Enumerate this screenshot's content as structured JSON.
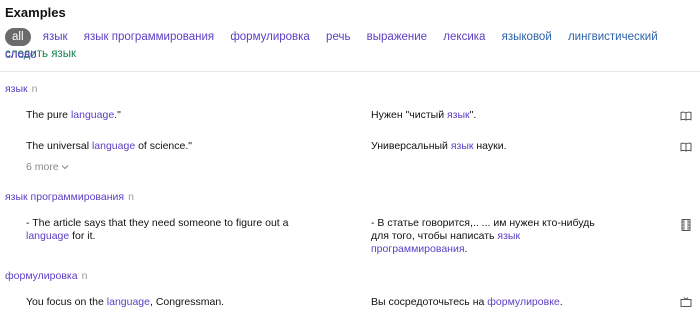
{
  "page": {
    "title": "Examples"
  },
  "filters": {
    "all": "all",
    "items": [
      "язык",
      "язык программирования",
      "формулировка",
      "речь",
      "выражение",
      "лексика",
      "языковой",
      "лингвистический",
      "следить язык"
    ],
    "wrap_item": "слово"
  },
  "sections": [
    {
      "word": "язык",
      "pos": "n",
      "examples": [
        {
          "en_pre": "The pure ",
          "en_hl": "language",
          "en_post": ".\"",
          "ru_pre": "Нужен \"чистый ",
          "ru_hl": "язык",
          "ru_post": "\".",
          "icon": "book-icon"
        },
        {
          "en_pre": "The universal ",
          "en_hl": "language",
          "en_post": " of science.\"",
          "ru_pre": "Универсальный ",
          "ru_hl": "язык",
          "ru_post": " науки.",
          "icon": "book-icon"
        }
      ],
      "more": "6 more"
    },
    {
      "word": "язык программирования",
      "pos": "n",
      "examples": [
        {
          "en_l1": "- The article says that they need someone to figure out a",
          "en_hl": "language",
          "en_post": " for it.",
          "ru_l1": "- В статье говорится,.. ... им нужен кто-нибудь",
          "ru_l2_pre": "для того, чтобы написать ",
          "ru_hl_1": "язык",
          "ru_hl_2": "программирования",
          "ru_post": ".",
          "icon": "film-icon"
        }
      ]
    },
    {
      "word": "формулировка",
      "pos": "n",
      "examples": [
        {
          "en_pre": "You focus on the ",
          "en_hl": "language",
          "en_post": ", Congressman.",
          "ru_pre": "Вы сосредоточьтесь на ",
          "ru_hl": "формулировке",
          "ru_post": ".",
          "icon": "tv-icon"
        }
      ]
    }
  ],
  "colors": {
    "accent": "#5b3fc4",
    "blue": "#2f62a8",
    "green": "#12804a",
    "chip_bg": "#6b6b6b"
  }
}
